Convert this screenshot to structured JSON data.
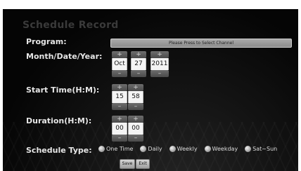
{
  "title": "Schedule Record",
  "labels": {
    "program": "Program:",
    "month_date_year": "Month/Date/Year:",
    "start_time": "Start Time(H:M):",
    "duration": "Duration(H:M):",
    "schedule_type": "Schedule Type:"
  },
  "program_button": "Please Press to Select Channel",
  "date": {
    "month": "Oct",
    "day": "27",
    "year": "2011"
  },
  "start_time": {
    "hour": "15",
    "minute": "58"
  },
  "duration": {
    "hour": "00",
    "minute": "00"
  },
  "stepper": {
    "plus": "+",
    "minus": "–"
  },
  "schedule_types": [
    "One Time",
    "Daily",
    "Weekly",
    "Weekday",
    "Sat~Sun"
  ],
  "buttons": {
    "save": "Save",
    "exit": "Exit"
  },
  "colors": {
    "background": "#0a0a0a",
    "label": "#e6e6e6",
    "title": "#3a3a3a"
  }
}
